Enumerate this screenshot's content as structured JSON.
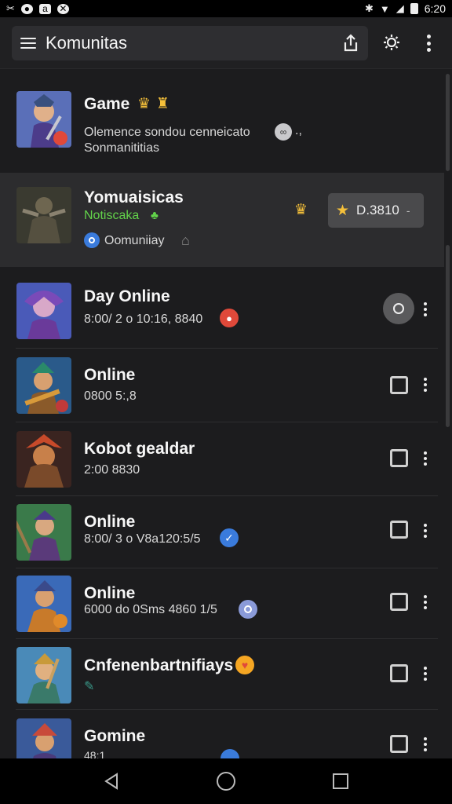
{
  "status": {
    "time": "6:20"
  },
  "app": {
    "title": "Komunitas"
  },
  "featured": {
    "title": "Game",
    "subtitle_line1": "Olemence sondou cenneicato",
    "subtitle_line2": "Sonmanititias"
  },
  "highlighted": {
    "title": "Yomuaisicas",
    "tag": "Notiscaka",
    "sub": "Oomuniiay",
    "button_label": "D.3810"
  },
  "rows": [
    {
      "title": "Day Online",
      "sub": "8:00/ 2 o 10:16, 8840"
    },
    {
      "title": "Online",
      "sub": "0800 5:,8"
    },
    {
      "title": "Kobot gealdar",
      "sub": "2:00 8830"
    },
    {
      "title": "Online",
      "sub": "8:00/ 3 o V8a120:5/5"
    },
    {
      "title": "Online",
      "sub": "6000 do 0Sms 4860 1/5"
    },
    {
      "title": "Cnfenenbartnifiays",
      "sub": ""
    },
    {
      "title": "Gomine",
      "sub": "48:1"
    }
  ],
  "colors": {
    "accent_green": "#62d34a",
    "badge_blue": "#3a7bdc",
    "star_gold": "#f5c03a",
    "badge_red": "#e0493a"
  }
}
